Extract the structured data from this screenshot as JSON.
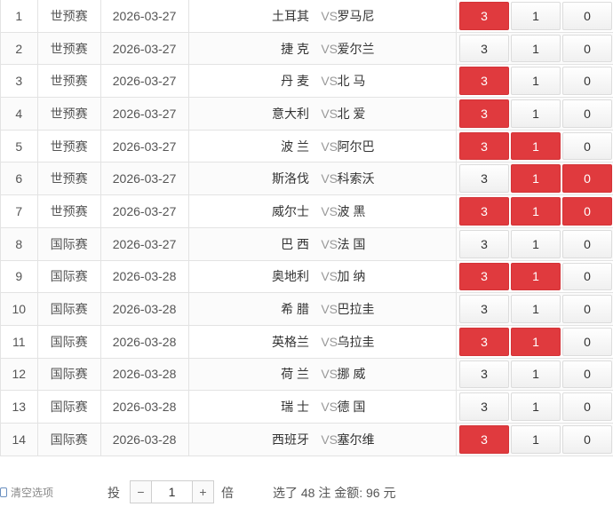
{
  "rows": [
    {
      "no": "1",
      "type": "世预赛",
      "date": "2026-03-27",
      "home": "土耳其",
      "vs": "VS",
      "away": "罗马尼",
      "o3": "3",
      "o1": "1",
      "o0": "0",
      "s3": true,
      "s1": false,
      "s0": false
    },
    {
      "no": "2",
      "type": "世预赛",
      "date": "2026-03-27",
      "home": "捷 克",
      "vs": "VS",
      "away": "爱尔兰",
      "o3": "3",
      "o1": "1",
      "o0": "0",
      "s3": false,
      "s1": false,
      "s0": false
    },
    {
      "no": "3",
      "type": "世预赛",
      "date": "2026-03-27",
      "home": "丹 麦",
      "vs": "VS",
      "away": "北 马",
      "o3": "3",
      "o1": "1",
      "o0": "0",
      "s3": true,
      "s1": false,
      "s0": false
    },
    {
      "no": "4",
      "type": "世预赛",
      "date": "2026-03-27",
      "home": "意大利",
      "vs": "VS",
      "away": "北 爱",
      "o3": "3",
      "o1": "1",
      "o0": "0",
      "s3": true,
      "s1": false,
      "s0": false
    },
    {
      "no": "5",
      "type": "世预赛",
      "date": "2026-03-27",
      "home": "波 兰",
      "vs": "VS",
      "away": "阿尔巴",
      "o3": "3",
      "o1": "1",
      "o0": "0",
      "s3": true,
      "s1": true,
      "s0": false
    },
    {
      "no": "6",
      "type": "世预赛",
      "date": "2026-03-27",
      "home": "斯洛伐",
      "vs": "VS",
      "away": "科索沃",
      "o3": "3",
      "o1": "1",
      "o0": "0",
      "s3": false,
      "s1": true,
      "s0": true
    },
    {
      "no": "7",
      "type": "世预赛",
      "date": "2026-03-27",
      "home": "威尔士",
      "vs": "VS",
      "away": "波 黑",
      "o3": "3",
      "o1": "1",
      "o0": "0",
      "s3": true,
      "s1": true,
      "s0": true
    },
    {
      "no": "8",
      "type": "国际赛",
      "date": "2026-03-27",
      "home": "巴 西",
      "vs": "VS",
      "away": "法 国",
      "o3": "3",
      "o1": "1",
      "o0": "0",
      "s3": false,
      "s1": false,
      "s0": false
    },
    {
      "no": "9",
      "type": "国际赛",
      "date": "2026-03-28",
      "home": "奥地利",
      "vs": "VS",
      "away": "加 纳",
      "o3": "3",
      "o1": "1",
      "o0": "0",
      "s3": true,
      "s1": true,
      "s0": false
    },
    {
      "no": "10",
      "type": "国际赛",
      "date": "2026-03-28",
      "home": "希 腊",
      "vs": "VS",
      "away": "巴拉圭",
      "o3": "3",
      "o1": "1",
      "o0": "0",
      "s3": false,
      "s1": false,
      "s0": false
    },
    {
      "no": "11",
      "type": "国际赛",
      "date": "2026-03-28",
      "home": "英格兰",
      "vs": "VS",
      "away": "乌拉圭",
      "o3": "3",
      "o1": "1",
      "o0": "0",
      "s3": true,
      "s1": true,
      "s0": false
    },
    {
      "no": "12",
      "type": "国际赛",
      "date": "2026-03-28",
      "home": "荷 兰",
      "vs": "VS",
      "away": "挪 威",
      "o3": "3",
      "o1": "1",
      "o0": "0",
      "s3": false,
      "s1": false,
      "s0": false
    },
    {
      "no": "13",
      "type": "国际赛",
      "date": "2026-03-28",
      "home": "瑞 士",
      "vs": "VS",
      "away": "德 国",
      "o3": "3",
      "o1": "1",
      "o0": "0",
      "s3": false,
      "s1": false,
      "s0": false
    },
    {
      "no": "14",
      "type": "国际赛",
      "date": "2026-03-28",
      "home": "西班牙",
      "vs": "VS",
      "away": "塞尔维",
      "o3": "3",
      "o1": "1",
      "o0": "0",
      "s3": true,
      "s1": false,
      "s0": false
    }
  ],
  "footer": {
    "clear_label": "清空选项",
    "bet_label": "投",
    "minus": "−",
    "multiplier": "1",
    "plus": "+",
    "times_label": "倍",
    "summary": "选了 48 注   金额:  96 元"
  },
  "colors": {
    "selected": "#e03a3e"
  }
}
